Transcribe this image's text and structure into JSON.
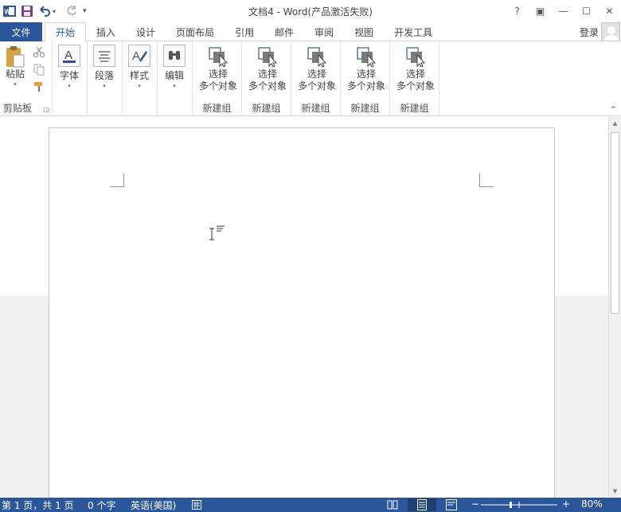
{
  "app": {
    "title": "文档4 - Word(产品激活失败)"
  },
  "quick_access": {
    "undo_dropdown": "▾",
    "customize": "▾"
  },
  "window_controls": {
    "help": "?",
    "ribbon_display": "▣",
    "minimize": "—",
    "maximize": "☐",
    "close": "✕"
  },
  "tabs": {
    "file": "文件",
    "items": [
      "开始",
      "插入",
      "设计",
      "页面布局",
      "引用",
      "邮件",
      "审阅",
      "视图",
      "开发工具"
    ],
    "active_index": 0,
    "login": "登录"
  },
  "ribbon": {
    "clipboard": {
      "paste_label": "粘贴",
      "group_label": "剪贴板"
    },
    "font": {
      "label": "字体"
    },
    "paragraph": {
      "label": "段落"
    },
    "styles": {
      "label": "样式"
    },
    "editing": {
      "label": "编辑"
    },
    "custom_groups": [
      {
        "line1": "选择",
        "line2": "多个对象",
        "group_label": "新建组"
      },
      {
        "line1": "选择",
        "line2": "多个对象",
        "group_label": "新建组"
      },
      {
        "line1": "选择",
        "line2": "多个对象",
        "group_label": "新建组"
      },
      {
        "line1": "选择",
        "line2": "多个对象",
        "group_label": "新建组"
      },
      {
        "line1": "选择",
        "line2": "多个对象",
        "group_label": "新建组"
      }
    ],
    "collapse_caret": "^"
  },
  "status_bar": {
    "page_info": "第 1 页，共 1 页",
    "word_count": "0 个字",
    "language": "英语(美国)",
    "zoom_level": "80%",
    "zoom_minus": "−",
    "zoom_plus": "+"
  },
  "colors": {
    "accent": "#2b579a",
    "ribbon_bg": "#ffffff",
    "doc_gray": "#f1f1f1"
  }
}
